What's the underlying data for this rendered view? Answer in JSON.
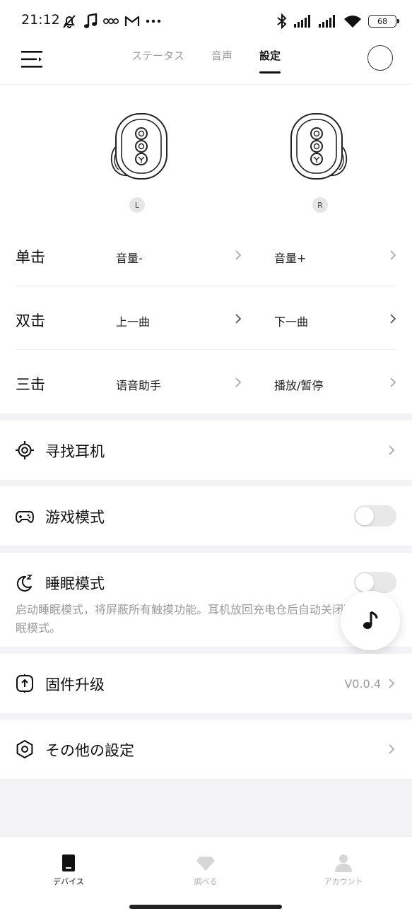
{
  "status_bar": {
    "time": "21:12",
    "battery": "68"
  },
  "top_nav": {
    "tabs": [
      {
        "label": "ステータス",
        "active": false
      },
      {
        "label": "音声",
        "active": false
      },
      {
        "label": "設定",
        "active": true
      }
    ]
  },
  "earbuds": {
    "left_label": "L",
    "right_label": "R"
  },
  "gestures": {
    "rows": [
      {
        "label": "单击",
        "left": "音量-",
        "right": "音量+"
      },
      {
        "label": "双击",
        "left": "上一曲",
        "right": "下一曲"
      },
      {
        "label": "三击",
        "left": "语音助手",
        "right": "播放/暂停"
      }
    ]
  },
  "find_earbuds": {
    "title": "寻找耳机",
    "icon": "crosshair-icon"
  },
  "game_mode": {
    "title": "游戏模式",
    "icon": "gamepad-icon",
    "enabled": false
  },
  "sleep_mode": {
    "title": "睡眠模式",
    "icon": "moon-icon",
    "enabled": false,
    "description": "启动睡眠模式，将屏蔽所有触摸功能。耳机放回充电仓后自动关闭睡眠模式。"
  },
  "firmware": {
    "title": "固件升级",
    "icon": "upgrade-icon",
    "version": "V0.0.4"
  },
  "other_settings": {
    "title": "その他の設定",
    "icon": "hexagon-settings-icon"
  },
  "bottom_nav": {
    "items": [
      {
        "label": "デバイス",
        "icon": "device-icon",
        "active": true
      },
      {
        "label": "調べる",
        "icon": "diamond-icon",
        "active": false
      },
      {
        "label": "アカウント",
        "icon": "person-icon",
        "active": false
      }
    ]
  },
  "colors": {
    "accent": "#111111",
    "inactive": "#9a9a9a",
    "background": "#f3f3f5"
  }
}
